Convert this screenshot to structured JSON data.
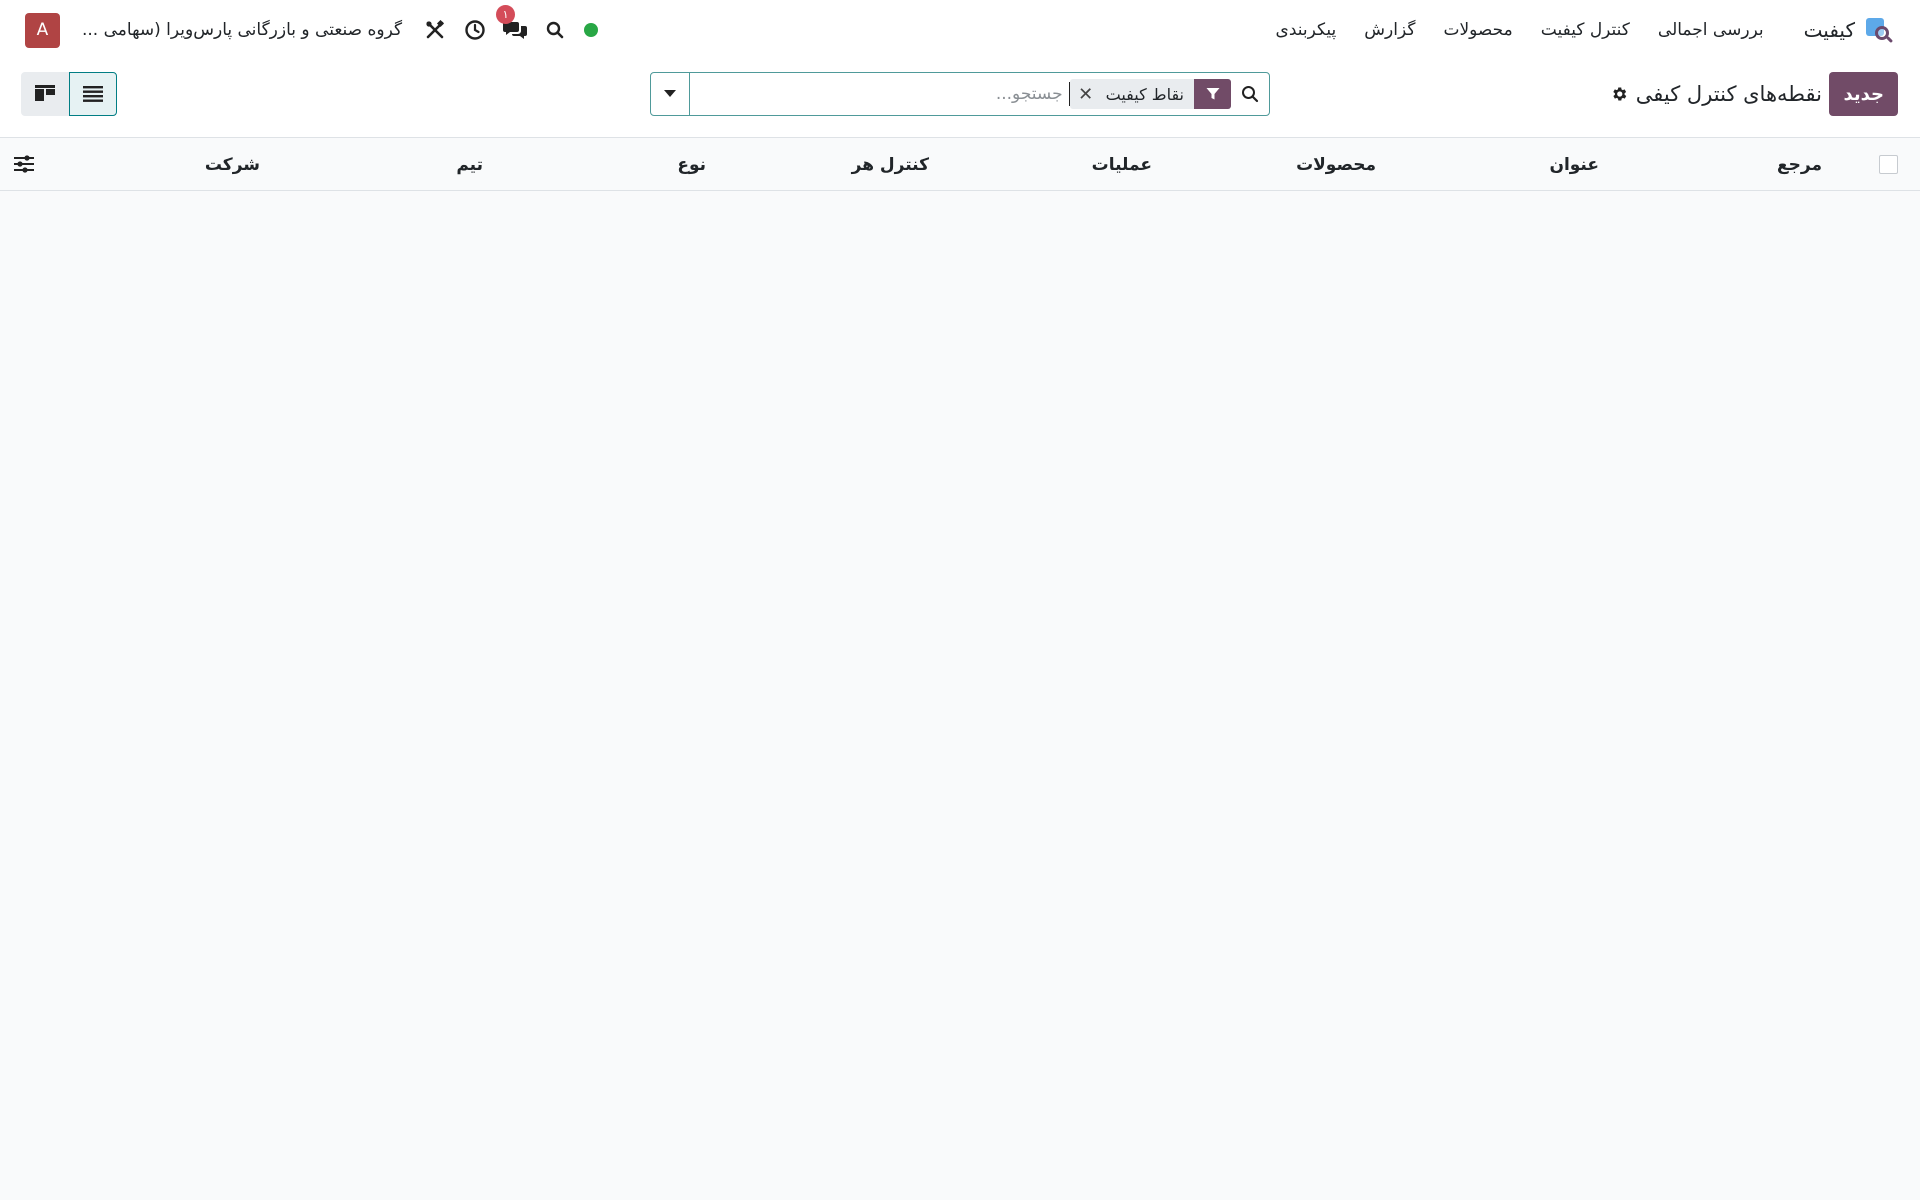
{
  "navbar": {
    "app_name": "کیفیت",
    "menu": [
      {
        "label": "بررسی اجمالی"
      },
      {
        "label": "کنترل کیفیت"
      },
      {
        "label": "محصولات"
      },
      {
        "label": "گزارش"
      },
      {
        "label": "پیکربندی"
      }
    ],
    "company": "گروه صنعتی و بازرگانی پارس‌ویرا (سهامی ...",
    "avatar_letter": "A",
    "chat_badge": "۱",
    "status_color": "#28a745"
  },
  "control_panel": {
    "new_button": "جدید",
    "title": "نقطه‌های کنترل کیفی",
    "search": {
      "facet": "نقاط کیفیت",
      "placeholder": "جستجو...",
      "value": ""
    }
  },
  "list": {
    "columns": [
      {
        "key": "reference",
        "label": "مرجع"
      },
      {
        "key": "title",
        "label": "عنوان"
      },
      {
        "key": "products",
        "label": "محصولات"
      },
      {
        "key": "operations",
        "label": "عملیات"
      },
      {
        "key": "control_per",
        "label": "کنترل هر"
      },
      {
        "key": "type",
        "label": "نوع"
      },
      {
        "key": "team",
        "label": "تیم"
      },
      {
        "key": "company",
        "label": "شرکت"
      }
    ],
    "rows": []
  },
  "colors": {
    "brand": "#714b67",
    "accent": "#017e84",
    "avatar": "#b04444",
    "badge": "#d44c59"
  }
}
